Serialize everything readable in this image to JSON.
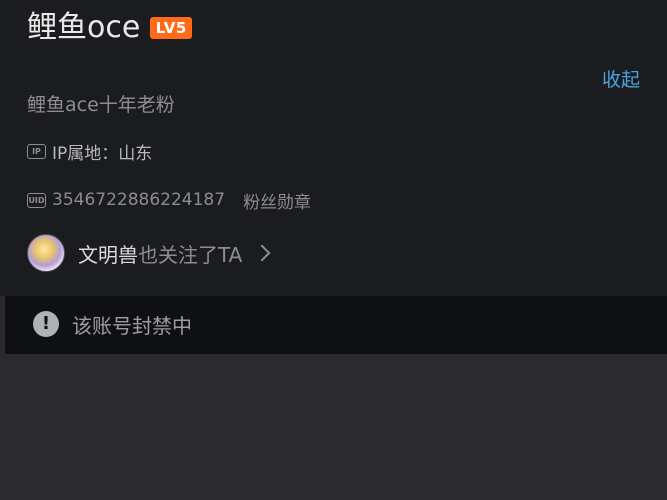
{
  "profile": {
    "username": "鲤鱼oce",
    "level_badge": "LV5",
    "collapse_label": "收起",
    "bio": "鲤鱼ace十年老粉",
    "ip_icon_label": "IP",
    "ip_location": "IP属地：山东",
    "uid_icon_label": "UID",
    "uid": "3546722886224187",
    "fans_medal_label": "粉丝勋章",
    "mutual_follow": {
      "name": "文明兽",
      "text": "也关注了TA"
    }
  },
  "banned_notice": {
    "icon": "!",
    "text": "该账号封禁中"
  },
  "colors": {
    "accent_link": "#4aa3e0",
    "level_badge": "#ff6b1a",
    "card_bg": "#1b1c1f",
    "banned_bg": "#0f1012"
  }
}
